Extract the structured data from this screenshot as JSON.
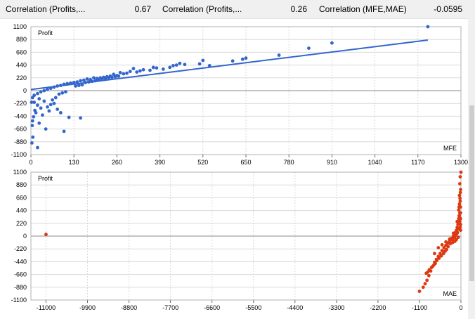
{
  "header": {
    "cells": [
      {
        "label": "Correlation (Profits,...",
        "value": "0.67"
      },
      {
        "label": "Correlation (Profits,...",
        "value": "0.26"
      },
      {
        "label": "Correlation (MFE,MAE)",
        "value": "-0.0595"
      }
    ]
  },
  "colors": {
    "series1": "#3366cc",
    "series2": "#dc3912",
    "grid": "#d9d9d9",
    "zero": "#888888"
  },
  "chart_data": [
    {
      "type": "scatter",
      "ylabel": "Profit",
      "xlabel": "MFE",
      "xlim": [
        0,
        1300
      ],
      "ylim": [
        -1100,
        1100
      ],
      "xticks": [
        0,
        130,
        260,
        390,
        520,
        650,
        780,
        910,
        1040,
        1170,
        1300
      ],
      "yticks": [
        1100,
        880,
        660,
        440,
        220,
        0,
        -220,
        -440,
        -660,
        -880,
        -1100
      ],
      "trendline": [
        [
          0,
          20
        ],
        [
          1200,
          870
        ]
      ],
      "points": [
        [
          1200,
          1100
        ],
        [
          910,
          820
        ],
        [
          840,
          730
        ],
        [
          750,
          610
        ],
        [
          650,
          560
        ],
        [
          640,
          540
        ],
        [
          520,
          520
        ],
        [
          510,
          460
        ],
        [
          450,
          470
        ],
        [
          430,
          430
        ],
        [
          420,
          400
        ],
        [
          400,
          370
        ],
        [
          380,
          390
        ],
        [
          360,
          350
        ],
        [
          330,
          340
        ],
        [
          310,
          380
        ],
        [
          300,
          330
        ],
        [
          280,
          290
        ],
        [
          270,
          310
        ],
        [
          260,
          260
        ],
        [
          250,
          280
        ],
        [
          240,
          250
        ],
        [
          230,
          240
        ],
        [
          220,
          230
        ],
        [
          210,
          220
        ],
        [
          200,
          210
        ],
        [
          190,
          220
        ],
        [
          180,
          190
        ],
        [
          170,
          200
        ],
        [
          160,
          180
        ],
        [
          150,
          170
        ],
        [
          140,
          150
        ],
        [
          130,
          140
        ],
        [
          120,
          130
        ],
        [
          110,
          120
        ],
        [
          100,
          110
        ],
        [
          90,
          90
        ],
        [
          80,
          80
        ],
        [
          70,
          60
        ],
        [
          60,
          40
        ],
        [
          50,
          20
        ],
        [
          40,
          0
        ],
        [
          30,
          -20
        ],
        [
          20,
          -50
        ],
        [
          10,
          -80
        ],
        [
          5,
          -120
        ],
        [
          10,
          -200
        ],
        [
          20,
          -250
        ],
        [
          30,
          -300
        ],
        [
          15,
          -380
        ],
        [
          5,
          -520
        ],
        [
          25,
          -560
        ],
        [
          35,
          -420
        ],
        [
          50,
          -280
        ],
        [
          60,
          -240
        ],
        [
          70,
          -220
        ],
        [
          90,
          -380
        ],
        [
          100,
          -700
        ],
        [
          150,
          -470
        ],
        [
          115,
          -460
        ],
        [
          80,
          -320
        ],
        [
          40,
          -180
        ],
        [
          25,
          -140
        ],
        [
          12,
          -340
        ],
        [
          8,
          -450
        ],
        [
          4,
          -600
        ],
        [
          2,
          -200
        ],
        [
          3,
          -900
        ],
        [
          6,
          -800
        ],
        [
          20,
          -980
        ],
        [
          45,
          -660
        ],
        [
          55,
          -350
        ],
        [
          65,
          -160
        ],
        [
          75,
          -120
        ],
        [
          85,
          -60
        ],
        [
          95,
          -40
        ],
        [
          105,
          -20
        ],
        [
          135,
          80
        ],
        [
          145,
          90
        ],
        [
          155,
          100
        ],
        [
          165,
          140
        ],
        [
          175,
          150
        ],
        [
          185,
          160
        ],
        [
          195,
          170
        ],
        [
          205,
          180
        ],
        [
          215,
          200
        ],
        [
          225,
          210
        ],
        [
          235,
          220
        ],
        [
          245,
          230
        ],
        [
          255,
          240
        ],
        [
          265,
          250
        ],
        [
          290,
          300
        ],
        [
          320,
          320
        ],
        [
          340,
          360
        ],
        [
          370,
          400
        ],
        [
          440,
          440
        ],
        [
          465,
          450
        ],
        [
          540,
          430
        ],
        [
          610,
          510
        ]
      ]
    },
    {
      "type": "scatter",
      "ylabel": "Profit",
      "xlabel": "MAE",
      "xlim": [
        -11400,
        0
      ],
      "ylim": [
        -1100,
        1100
      ],
      "xticks": [
        -11000,
        -9900,
        -8800,
        -7700,
        -6600,
        -5500,
        -4400,
        -3300,
        -2200,
        -1100,
        0
      ],
      "yticks": [
        1100,
        880,
        660,
        440,
        220,
        0,
        -220,
        -440,
        -660,
        -880,
        -1100
      ],
      "points": [
        [
          -11000,
          30
        ],
        [
          0,
          1100
        ],
        [
          -20,
          1020
        ],
        [
          -30,
          900
        ],
        [
          -10,
          800
        ],
        [
          -40,
          700
        ],
        [
          -20,
          600
        ],
        [
          -50,
          500
        ],
        [
          -30,
          400
        ],
        [
          -60,
          300
        ],
        [
          -80,
          200
        ],
        [
          -100,
          150
        ],
        [
          -120,
          100
        ],
        [
          -150,
          60
        ],
        [
          -180,
          20
        ],
        [
          -200,
          0
        ],
        [
          -250,
          -40
        ],
        [
          -300,
          -80
        ],
        [
          -350,
          -120
        ],
        [
          -400,
          -160
        ],
        [
          -450,
          -200
        ],
        [
          -500,
          -250
        ],
        [
          -550,
          -300
        ],
        [
          -600,
          -350
        ],
        [
          -650,
          -400
        ],
        [
          -700,
          -450
        ],
        [
          -750,
          -520
        ],
        [
          -800,
          -600
        ],
        [
          -850,
          -680
        ],
        [
          -900,
          -760
        ],
        [
          -950,
          -820
        ],
        [
          -1000,
          -880
        ],
        [
          -1100,
          -950
        ],
        [
          -600,
          -200
        ],
        [
          -700,
          -300
        ],
        [
          -500,
          -150
        ],
        [
          -400,
          -100
        ],
        [
          -300,
          -50
        ],
        [
          -200,
          50
        ],
        [
          -100,
          250
        ],
        [
          -50,
          350
        ],
        [
          -60,
          450
        ],
        [
          -40,
          550
        ],
        [
          -25,
          650
        ],
        [
          -15,
          750
        ],
        [
          -70,
          -20
        ],
        [
          -120,
          -60
        ],
        [
          -160,
          -90
        ],
        [
          -220,
          -110
        ],
        [
          -280,
          -130
        ],
        [
          -340,
          -180
        ],
        [
          -380,
          -230
        ],
        [
          -420,
          -260
        ],
        [
          -460,
          -300
        ],
        [
          -520,
          -340
        ],
        [
          -580,
          -380
        ],
        [
          -640,
          -420
        ],
        [
          -680,
          -470
        ],
        [
          -720,
          -500
        ],
        [
          -780,
          -540
        ],
        [
          -840,
          -580
        ],
        [
          -880,
          -620
        ],
        [
          -920,
          -640
        ],
        [
          -10,
          100
        ],
        [
          -10,
          200
        ],
        [
          -10,
          300
        ],
        [
          -10,
          400
        ],
        [
          -10,
          500
        ],
        [
          -20,
          150
        ],
        [
          -30,
          250
        ],
        [
          -40,
          350
        ],
        [
          -70,
          120
        ],
        [
          -90,
          60
        ],
        [
          -110,
          40
        ],
        [
          -140,
          10
        ],
        [
          -170,
          -30
        ],
        [
          -230,
          -60
        ]
      ]
    }
  ]
}
